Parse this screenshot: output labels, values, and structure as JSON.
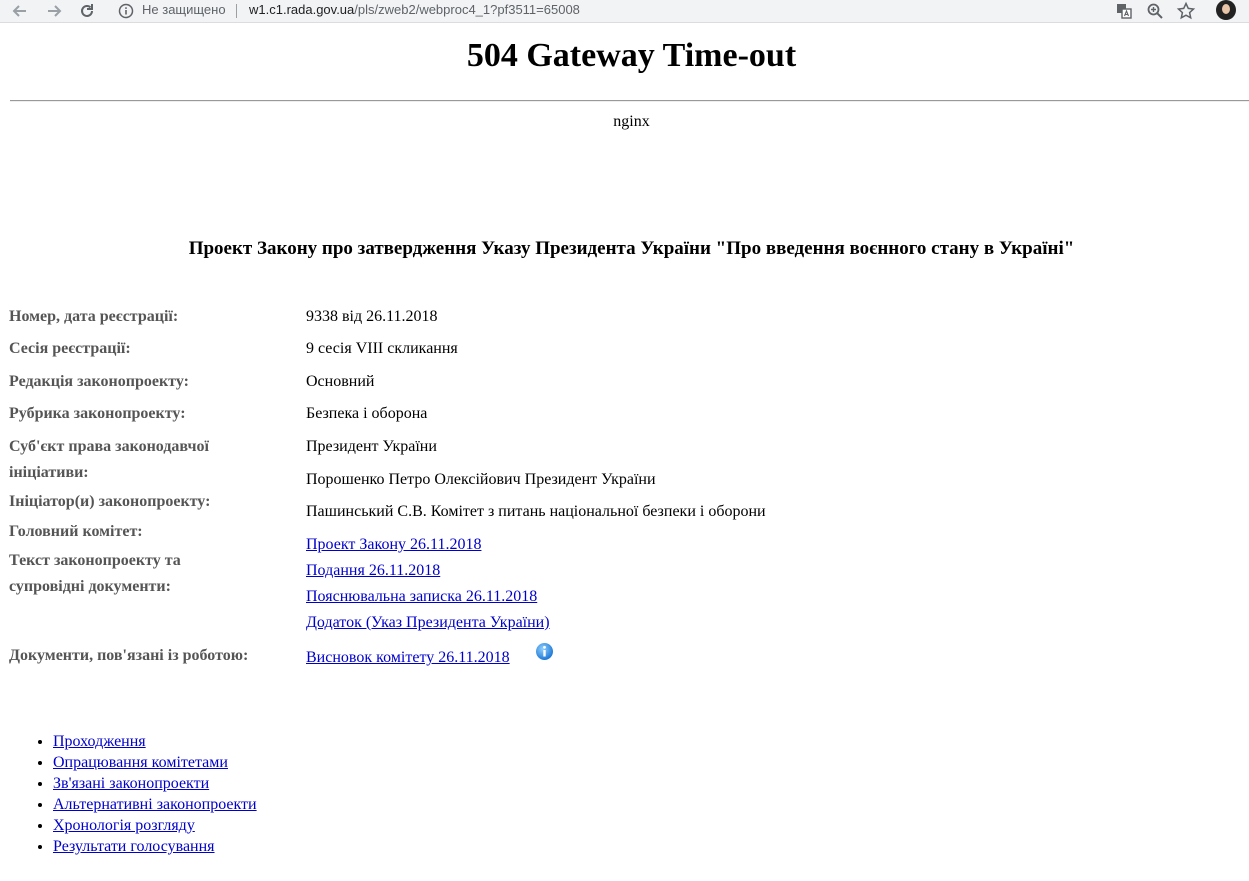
{
  "browser": {
    "security_label": "Не защищено",
    "url_host": "w1.c1.rada.gov.ua",
    "url_path": "/pls/zweb2/webproc4_1?pf3511=65008"
  },
  "error": {
    "title": "504 Gateway Time-out",
    "server": "nginx"
  },
  "bill": {
    "title": "Проект Закону про затвердження Указу Президента України \"Про введення воєнного стану в Україні\"",
    "labels": {
      "number_date": "Номер, дата реєстрації:",
      "session": "Сесія реєстрації:",
      "edition": "Редакція законопроекту:",
      "rubric": "Рубрика законопроекту:",
      "subject_line1": "Суб'єкт права законодавчої",
      "subject_line2": "ініціативи:",
      "initiator": "Ініціатор(и) законопроекту:",
      "committee": "Головний комітет:",
      "texts_line1": "Текст законопроекту та",
      "texts_line2": "супровідні документи:",
      "related_docs": "Документи, пов'язані із роботою:"
    },
    "values": {
      "number_date": "9338 від 26.11.2018",
      "session": "9 сесія VIII скликання",
      "edition": "Основний",
      "rubric": "Безпека і оборона",
      "subject": "Президент України",
      "initiator": "Порошенко Петро Олексійович Президент України",
      "committee": "Пашинський С.В. Комітет з питань національної безпеки і оборони"
    },
    "documents": [
      "Проект Закону 26.11.2018",
      "Подання 26.11.2018",
      "Пояснювальна записка 26.11.2018",
      "Додаток (Указ Президента України)"
    ],
    "related_document": "Висновок комітету 26.11.2018"
  },
  "nav_links": [
    "Проходження",
    "Опрацювання комітетами",
    "Зв'язані законопроекти",
    "Альтернативні законопроекти",
    "Хронологія розгляду",
    "Результати голосування"
  ],
  "colors": {
    "link": "#0000cc",
    "label": "#555555",
    "info_icon": "#1e90ff"
  }
}
